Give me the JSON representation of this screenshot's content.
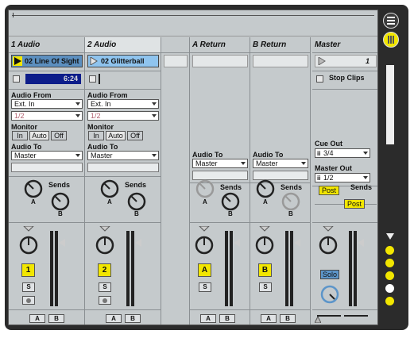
{
  "tracks": [
    {
      "name": "1 Audio",
      "clip": "02 Line Of Sight",
      "time": "6:24",
      "audio_from_label": "Audio From",
      "audio_from": "Ext. In",
      "channel": "1/2",
      "monitor_label": "Monitor",
      "monitor": [
        "In",
        "Auto",
        "Off"
      ],
      "audio_to_label": "Audio To",
      "audio_to": "Master",
      "sends_label": "Sends",
      "knob_a": "A",
      "knob_b": "B",
      "track_button": "1",
      "solo_label": "S",
      "xfade_a": "A",
      "xfade_b": "B"
    },
    {
      "name": "2 Audio",
      "clip": "02 Glitterball",
      "audio_from_label": "Audio From",
      "audio_from": "Ext. In",
      "channel": "1/2",
      "monitor_label": "Monitor",
      "monitor": [
        "In",
        "Auto",
        "Off"
      ],
      "audio_to_label": "Audio To",
      "audio_to": "Master",
      "sends_label": "Sends",
      "knob_a": "A",
      "knob_b": "B",
      "track_button": "2",
      "solo_label": "S",
      "xfade_a": "A",
      "xfade_b": "B"
    }
  ],
  "returns": [
    {
      "name": "A Return",
      "audio_to_label": "Audio To",
      "audio_to": "Master",
      "sends_label": "Sends",
      "knob_a": "A",
      "knob_b": "B",
      "track_button": "A",
      "solo_label": "S",
      "xfade_a": "A",
      "xfade_b": "B"
    },
    {
      "name": "B Return",
      "audio_to_label": "Audio To",
      "audio_to": "Master",
      "sends_label": "Sends",
      "knob_a": "A",
      "knob_b": "B",
      "track_button": "B",
      "solo_label": "S",
      "xfade_a": "A",
      "xfade_b": "B"
    }
  ],
  "master": {
    "name": "Master",
    "scene": "1",
    "stop_clips": "Stop Clips",
    "cue_out_label": "Cue Out",
    "cue_out": "3/4",
    "master_out_label": "Master Out",
    "master_out": "1/2",
    "sends_label": "Sends",
    "post_a": "Post",
    "post_b": "Post",
    "solo": "Solo"
  },
  "right_bar_icons": [
    "mixer-icon",
    "session-icon",
    "browser-icon",
    "io-icon",
    "sends-icon",
    "return-icon",
    "delay-icon",
    "crossfader-icon"
  ],
  "colors": {
    "clip_play": "#f2e600",
    "clip_yellow_bg": "#5c8fbf",
    "clip_blue": "#8fc4ee",
    "time_bg": "#0d1d8a",
    "track_button": "#f2e600",
    "solo": "#5c95c9"
  }
}
